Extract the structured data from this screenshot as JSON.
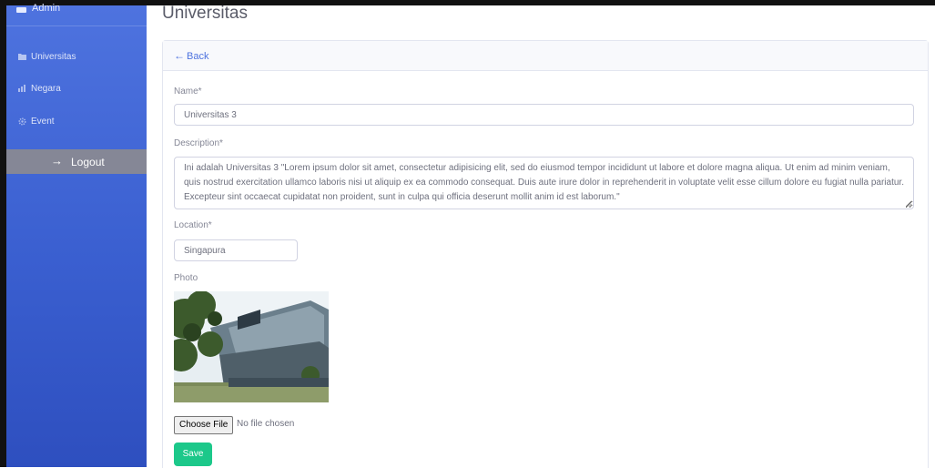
{
  "sidebar": {
    "brand": "Admin",
    "items": [
      {
        "icon": "folder-icon",
        "label": "Universitas"
      },
      {
        "icon": "bar-chart-icon",
        "label": "Negara"
      },
      {
        "icon": "gear-icon",
        "label": "Event"
      }
    ],
    "logout_label": "Logout"
  },
  "page": {
    "title": "Universitas"
  },
  "form": {
    "back_label": "Back",
    "name_label": "Name*",
    "name_value": "Universitas 3",
    "description_label": "Description*",
    "description_value": "Ini adalah Universitas 3 \"Lorem ipsum dolor sit amet, consectetur adipisicing elit, sed do eiusmod tempor incididunt ut labore et dolore magna aliqua. Ut enim ad minim veniam, quis nostrud exercitation ullamco laboris nisi ut aliquip ex ea commodo consequat. Duis aute irure dolor in reprehenderit in voluptate velit esse cillum dolore eu fugiat nulla pariatur. Excepteur sint occaecat cupidatat non proident, sunt in culpa qui officia deserunt mollit anim id est laborum.\"",
    "location_label": "Location*",
    "location_value": "Singapura",
    "photo_label": "Photo",
    "file_button_label": "Choose File",
    "file_status": "No file chosen",
    "save_label": "Save"
  },
  "colors": {
    "sidebar": "#4e73df",
    "logout_bg": "#858796",
    "link": "#4e73df",
    "save": "#1cc88a"
  }
}
